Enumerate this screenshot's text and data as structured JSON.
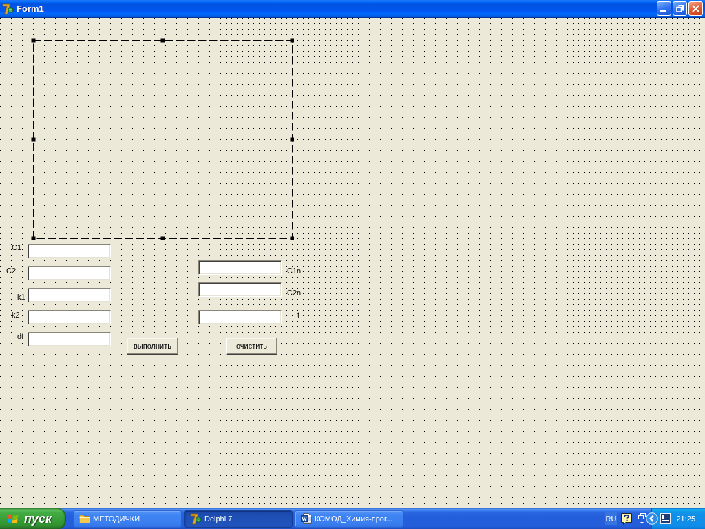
{
  "window": {
    "title": "Form1"
  },
  "form": {
    "component_frame": {
      "selected": true
    },
    "input_fields": [
      {
        "label": "C1"
      },
      {
        "label": "C2"
      },
      {
        "label": "k1"
      },
      {
        "label": "k2"
      },
      {
        "label": "dt"
      }
    ],
    "output_fields": [
      {
        "label": "C1n"
      },
      {
        "label": "C2n"
      },
      {
        "label": "t"
      }
    ],
    "buttons": [
      "выполнить",
      "очистить"
    ]
  },
  "taskbar": {
    "start_button": "пуск",
    "tasks": [
      {
        "label": "МЕТОДИЧКИ",
        "kind": "folder",
        "selected": false
      },
      {
        "label": "Delphi 7",
        "kind": "app",
        "selected": true
      },
      {
        "label": "КОМОД_Химия-прог...",
        "kind": "document",
        "selected": false
      }
    ],
    "tray": {
      "language": "RU",
      "clock": "21:25"
    }
  }
}
